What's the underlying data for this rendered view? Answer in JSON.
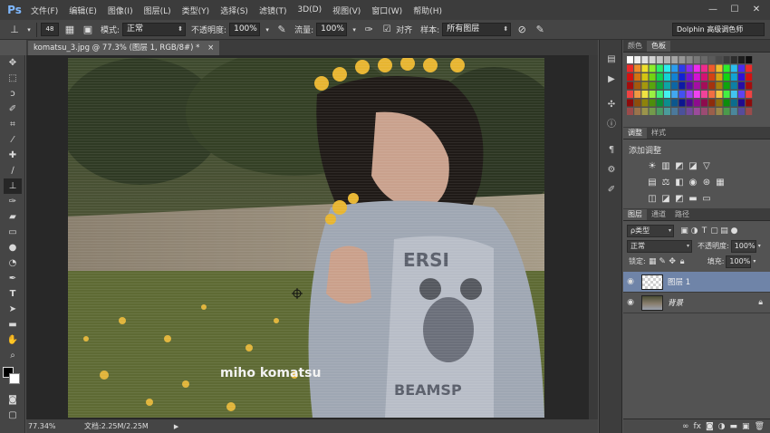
{
  "app": {
    "logo": "Ps"
  },
  "menu": [
    "文件(F)",
    "编辑(E)",
    "图像(I)",
    "图层(L)",
    "类型(Y)",
    "选择(S)",
    "滤镜(T)",
    "3D(D)",
    "视图(V)",
    "窗口(W)",
    "帮助(H)"
  ],
  "options": {
    "brush_size": "48",
    "mode_label": "模式:",
    "mode_value": "正常",
    "opacity_label": "不透明度:",
    "opacity_value": "100%",
    "flow_label": "流量:",
    "flow_value": "100%",
    "align_label": "对齐",
    "sample_label": "样本:",
    "sample_value": "所有图层",
    "workspace": "Dolphin 高级调色师"
  },
  "document": {
    "tab_title": "komatsu_3.jpg @ 77.3% (图层 1, RGB/8#) *",
    "watermark": "miho komatsu"
  },
  "status": {
    "zoom": "77.34%",
    "doc_info": "文档:2.25M/2.25M"
  },
  "panels": {
    "color_tabs": [
      "颜色",
      "色板"
    ],
    "adjust_tabs": [
      "调整",
      "样式"
    ],
    "adjust_title": "添加调整",
    "layers_tabs": [
      "图层",
      "通道",
      "路径"
    ],
    "filter_kind": "ρ类型",
    "blend_mode": "正常",
    "opacity_label": "不透明度:",
    "opacity_value": "100%",
    "lock_label": "锁定:",
    "fill_label": "填充:",
    "fill_value": "100%",
    "layers": [
      {
        "name": "图层 1",
        "selected": true
      },
      {
        "name": "背景",
        "locked": true
      }
    ]
  },
  "colors": {
    "selection": "#6f84a8",
    "panel": "#535353",
    "chrome": "#3c3c3c"
  }
}
